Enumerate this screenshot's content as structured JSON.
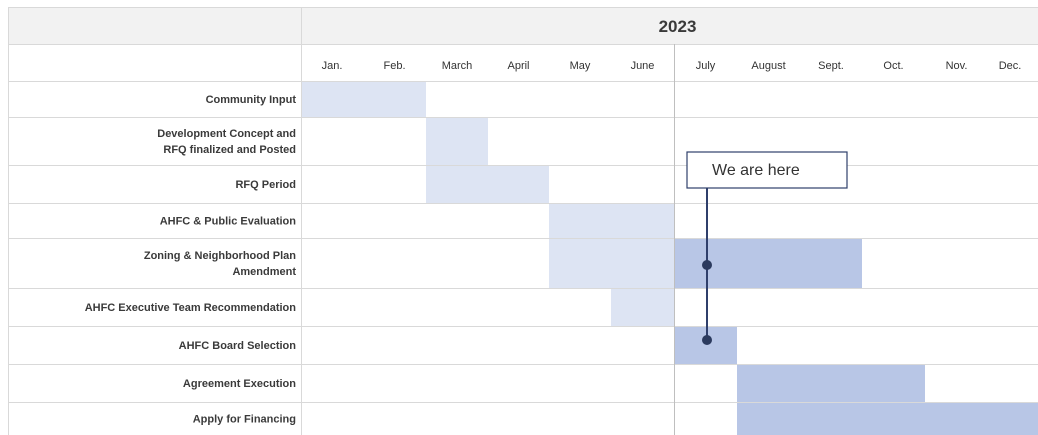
{
  "chart_data": {
    "type": "gantt",
    "year": "2023",
    "months": [
      "Jan.",
      "Feb.",
      "March",
      "April",
      "May",
      "June",
      "July",
      "August",
      "Sept.",
      "Oct.",
      "Nov.",
      "Dec."
    ],
    "tasks": [
      {
        "label": [
          "Community Input"
        ],
        "start": 1,
        "end": 2,
        "color": "#dde4f3"
      },
      {
        "label": [
          "Development Concept and",
          "RFQ finalized and Posted"
        ],
        "start": 3,
        "end": 3,
        "color": "#dde4f3"
      },
      {
        "label": [
          "RFQ Period"
        ],
        "start": 3,
        "end": 4,
        "color": "#dde4f3"
      },
      {
        "label": [
          "AHFC & Public Evaluation"
        ],
        "start": 5,
        "end": 6,
        "color": "#dde4f3"
      },
      {
        "label": [
          "Zoning & Neighborhood Plan",
          "Amendment"
        ],
        "start": 5,
        "end": 6,
        "color": "#dde4f3",
        "extra": {
          "start": 7,
          "end": 9,
          "color": "#b8c6e6"
        }
      },
      {
        "label": [
          "AHFC Executive Team Recommendation"
        ],
        "start": 6,
        "end": 6,
        "color": "#dde4f3"
      },
      {
        "label": [
          "AHFC Board Selection"
        ],
        "start": 7,
        "end": 7,
        "color": "#b8c6e6"
      },
      {
        "label": [
          "Agreement Execution"
        ],
        "start": 8,
        "end": 10,
        "color": "#b8c6e6"
      },
      {
        "label": [
          "Apply for Financing"
        ],
        "start": 8,
        "end": 12,
        "color": "#b8c6e6"
      }
    ],
    "marker": {
      "label": "We are here",
      "month": 7,
      "dots_on_tasks": [
        5,
        7
      ]
    },
    "colors": {
      "header_bg": "#f2f2f2",
      "grid": "#d9d9d9",
      "marker_line": "#2f3f6b",
      "marker_dot": "#2b3a5e"
    }
  }
}
